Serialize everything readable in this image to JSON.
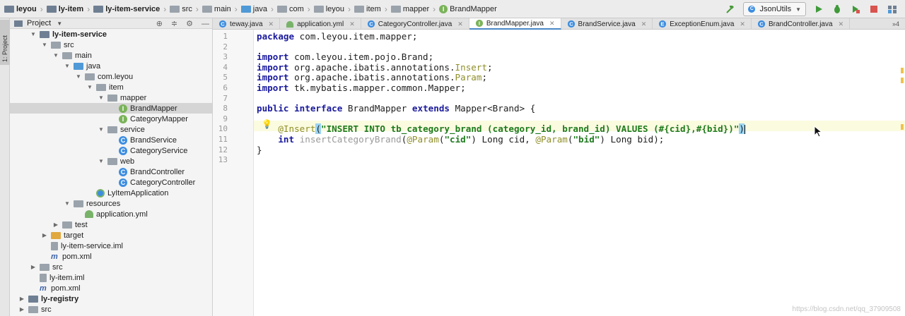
{
  "breadcrumbs": [
    {
      "label": "leyou",
      "icon": "module-folder-icon",
      "bold": true
    },
    {
      "label": "ly-item",
      "icon": "module-folder-icon",
      "bold": true
    },
    {
      "label": "ly-item-service",
      "icon": "module-folder-icon",
      "bold": true
    },
    {
      "label": "src",
      "icon": "folder-icon",
      "bold": false
    },
    {
      "label": "main",
      "icon": "folder-icon",
      "bold": false
    },
    {
      "label": "java",
      "icon": "source-folder-icon",
      "bold": false
    },
    {
      "label": "com",
      "icon": "package-icon",
      "bold": false
    },
    {
      "label": "leyou",
      "icon": "package-icon",
      "bold": false
    },
    {
      "label": "item",
      "icon": "package-icon",
      "bold": false
    },
    {
      "label": "mapper",
      "icon": "package-icon",
      "bold": false
    },
    {
      "label": "BrandMapper",
      "icon": "interface-icon",
      "bold": false
    }
  ],
  "toolbar": {
    "run_config": "JsonUtils",
    "icons": [
      "hammer-icon",
      "run-icon",
      "debug-icon",
      "coverage-icon",
      "stop-icon",
      "project-structure-icon"
    ]
  },
  "side_stripe": {
    "label": "1: Project"
  },
  "project_panel": {
    "title": "Project",
    "tools": [
      "sync-icon",
      "collapse-icon",
      "gear-icon",
      "hide-icon"
    ]
  },
  "tree": [
    {
      "label": "ly-item-service",
      "depth": 3,
      "arrow": "open",
      "icon": "module",
      "bold": true
    },
    {
      "label": "src",
      "depth": 4,
      "arrow": "open",
      "icon": "folder"
    },
    {
      "label": "main",
      "depth": 5,
      "arrow": "open",
      "icon": "folder"
    },
    {
      "label": "java",
      "depth": 6,
      "arrow": "open",
      "icon": "src"
    },
    {
      "label": "com.leyou",
      "depth": 7,
      "arrow": "open",
      "icon": "package"
    },
    {
      "label": "item",
      "depth": 8,
      "arrow": "open",
      "icon": "package"
    },
    {
      "label": "mapper",
      "depth": 9,
      "arrow": "open",
      "icon": "package"
    },
    {
      "label": "BrandMapper",
      "depth": 10,
      "arrow": "none",
      "icon": "interface",
      "selected": true
    },
    {
      "label": "CategoryMapper",
      "depth": 10,
      "arrow": "none",
      "icon": "interface"
    },
    {
      "label": "service",
      "depth": 9,
      "arrow": "open",
      "icon": "package"
    },
    {
      "label": "BrandService",
      "depth": 10,
      "arrow": "none",
      "icon": "class"
    },
    {
      "label": "CategoryService",
      "depth": 10,
      "arrow": "none",
      "icon": "class"
    },
    {
      "label": "web",
      "depth": 9,
      "arrow": "open",
      "icon": "package"
    },
    {
      "label": "BrandController",
      "depth": 10,
      "arrow": "none",
      "icon": "class"
    },
    {
      "label": "CategoryController",
      "depth": 10,
      "arrow": "none",
      "icon": "class"
    },
    {
      "label": "LyItemApplication",
      "depth": 8,
      "arrow": "none",
      "icon": "app"
    },
    {
      "label": "resources",
      "depth": 6,
      "arrow": "open",
      "icon": "resources"
    },
    {
      "label": "application.yml",
      "depth": 7,
      "arrow": "none",
      "icon": "yml"
    },
    {
      "label": "test",
      "depth": 5,
      "arrow": "closed",
      "icon": "folder"
    },
    {
      "label": "target",
      "depth": 4,
      "arrow": "closed",
      "icon": "yellow"
    },
    {
      "label": "ly-item-service.iml",
      "depth": 4,
      "arrow": "none",
      "icon": "file"
    },
    {
      "label": "pom.xml",
      "depth": 4,
      "arrow": "none",
      "icon": "xml"
    },
    {
      "label": "src",
      "depth": 3,
      "arrow": "closed",
      "icon": "folder"
    },
    {
      "label": "ly-item.iml",
      "depth": 3,
      "arrow": "none",
      "icon": "file"
    },
    {
      "label": "pom.xml",
      "depth": 3,
      "arrow": "none",
      "icon": "xml"
    },
    {
      "label": "ly-registry",
      "depth": 2,
      "arrow": "closed",
      "icon": "module",
      "bold": true
    },
    {
      "label": "src",
      "depth": 2,
      "arrow": "closed",
      "icon": "folder"
    }
  ],
  "tabs": [
    {
      "label": "teway.java",
      "icon": "class",
      "active": false
    },
    {
      "label": "application.yml",
      "icon": "yml",
      "active": false
    },
    {
      "label": "CategoryController.java",
      "icon": "class",
      "active": false
    },
    {
      "label": "BrandMapper.java",
      "icon": "interface",
      "active": true
    },
    {
      "label": "BrandService.java",
      "icon": "class",
      "active": false
    },
    {
      "label": "ExceptionEnum.java",
      "icon": "enum",
      "active": false
    },
    {
      "label": "BrandController.java",
      "icon": "class",
      "active": false
    }
  ],
  "tab_overflow": "»4",
  "line_numbers": [
    "1",
    "2",
    "3",
    "4",
    "5",
    "6",
    "7",
    "8",
    "9",
    "10",
    "11",
    "12",
    "13"
  ],
  "code_lines": [
    [
      {
        "t": "package",
        "c": "kw"
      },
      {
        "t": " com.leyou.item.mapper;",
        "c": ""
      }
    ],
    [],
    [
      {
        "t": "import",
        "c": "kw"
      },
      {
        "t": " com.leyou.item.pojo.Brand;",
        "c": ""
      }
    ],
    [
      {
        "t": "import",
        "c": "kw"
      },
      {
        "t": " org.apache.ibatis.annotations.",
        "c": ""
      },
      {
        "t": "Insert",
        "c": "ann"
      },
      {
        "t": ";",
        "c": ""
      }
    ],
    [
      {
        "t": "import",
        "c": "kw"
      },
      {
        "t": " org.apache.ibatis.annotations.",
        "c": ""
      },
      {
        "t": "Param",
        "c": "ann"
      },
      {
        "t": ";",
        "c": ""
      }
    ],
    [
      {
        "t": "import",
        "c": "kw"
      },
      {
        "t": " tk.mybatis.mapper.common.Mapper;",
        "c": ""
      }
    ],
    [],
    [
      {
        "t": "public",
        "c": "kw"
      },
      {
        "t": " ",
        "c": ""
      },
      {
        "t": "interface",
        "c": "kw"
      },
      {
        "t": " BrandMapper ",
        "c": ""
      },
      {
        "t": "extends",
        "c": "kw"
      },
      {
        "t": " Mapper<Brand> {",
        "c": ""
      }
    ],
    [],
    [
      {
        "t": "    ",
        "c": ""
      },
      {
        "t": "@Insert",
        "c": "ann"
      },
      {
        "t": "(",
        "c": "paren-match"
      },
      {
        "t": "\"INSERT INTO tb_category_brand (category_id, brand_id) VALUES (#{cid},#{bid})\"",
        "c": "str"
      },
      {
        "t": ")",
        "c": "paren-match"
      },
      {
        "t": "|",
        "c": "caret"
      }
    ],
    [
      {
        "t": "    ",
        "c": ""
      },
      {
        "t": "int",
        "c": "kw"
      },
      {
        "t": " ",
        "c": ""
      },
      {
        "t": "insertCategoryBrand",
        "c": "param-dim"
      },
      {
        "t": "(",
        "c": ""
      },
      {
        "t": "@Param",
        "c": "ann"
      },
      {
        "t": "(",
        "c": ""
      },
      {
        "t": "\"cid\"",
        "c": "str"
      },
      {
        "t": ") Long cid, ",
        "c": ""
      },
      {
        "t": "@Param",
        "c": "ann"
      },
      {
        "t": "(",
        "c": ""
      },
      {
        "t": "\"bid\"",
        "c": "str"
      },
      {
        "t": ") Long bid);",
        "c": ""
      }
    ],
    [
      {
        "t": "}",
        "c": ""
      }
    ],
    []
  ],
  "watermark": "https://blog.csdn.net/qq_37909508"
}
